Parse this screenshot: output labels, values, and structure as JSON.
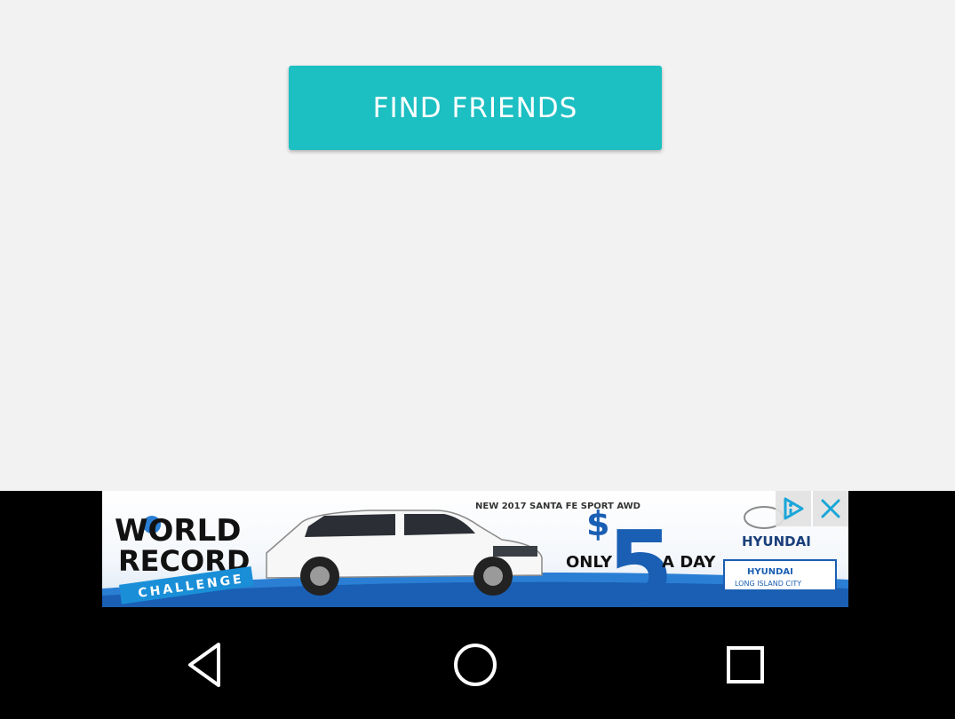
{
  "main": {
    "find_friends_label": "FIND FRIENDS"
  },
  "ad": {
    "headline_line1": "WORLD",
    "headline_line2": "RECORD",
    "ribbon": "CHALLENGE",
    "model_line": "NEW 2017 SANTA FE SPORT AWD",
    "price_symbol": "$",
    "price_number": "5",
    "price_left": "ONLY",
    "price_right": "A DAY",
    "brand": "HYUNDAI",
    "dealer_line1": "HYUNDAI",
    "dealer_line2": "LONG ISLAND CITY",
    "adchoices_icon": "adchoices-icon",
    "close_icon": "close-icon"
  },
  "navigation": {
    "back_icon": "back-triangle-icon",
    "home_icon": "home-circle-icon",
    "recents_icon": "recents-square-icon"
  },
  "colors": {
    "accent": "#1cbfc2",
    "background": "#f2f2f2",
    "ad_blue": "#1a5fb4",
    "nav_bar": "#000000"
  }
}
